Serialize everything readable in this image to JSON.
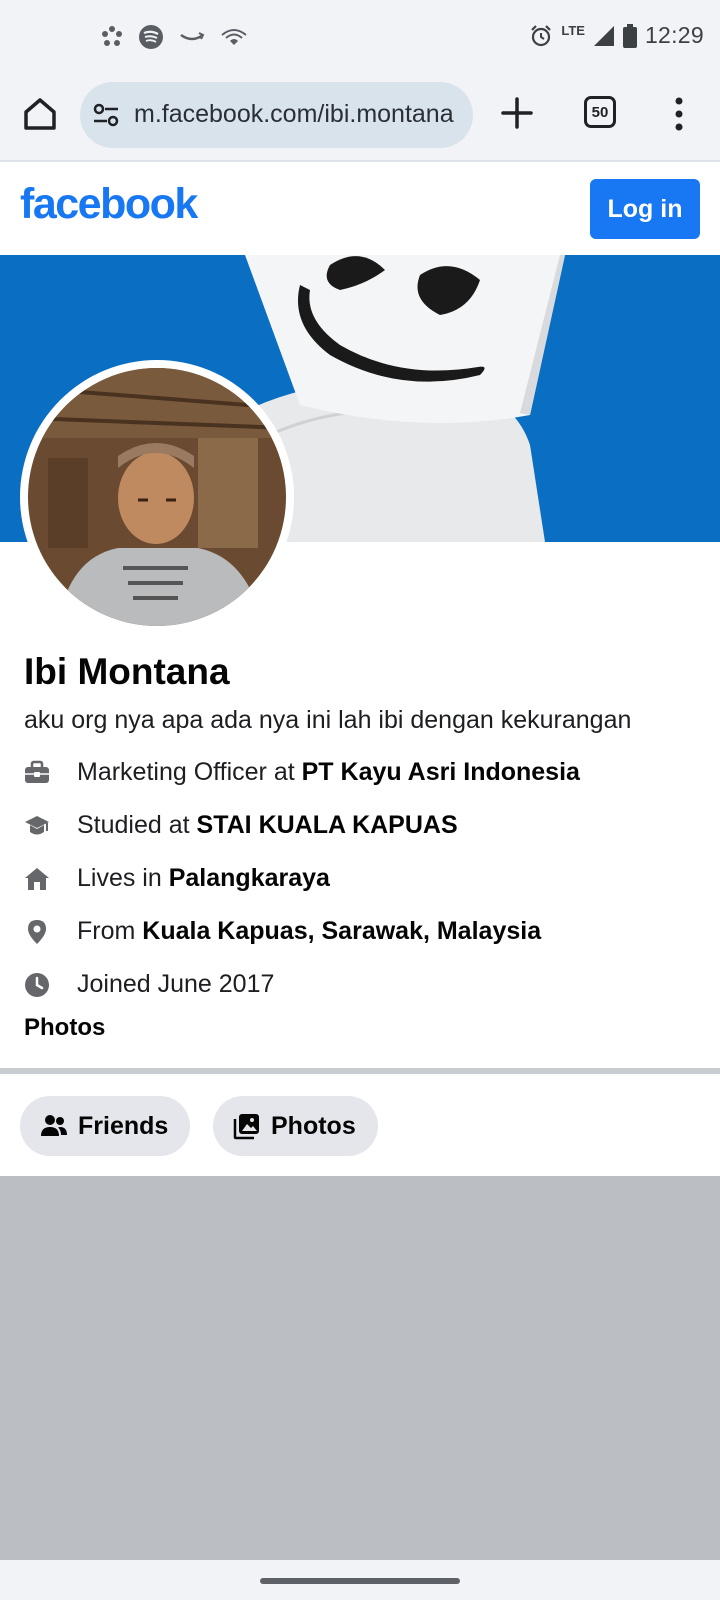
{
  "status_bar": {
    "time": "12:29",
    "network": "LTE",
    "left_icons": [
      "pinwheel-icon",
      "spotify-icon",
      "amazon-smile-icon",
      "wifi-calling-icon"
    ],
    "right_icons": [
      "alarm-icon",
      "signal-icon",
      "battery-icon"
    ]
  },
  "browser": {
    "url": "m.facebook.com/ibi.montana",
    "tab_count": "50"
  },
  "header": {
    "logo": "facebook",
    "login_label": "Log in",
    "brand_color": "#1877f2"
  },
  "profile": {
    "name": "Ibi Montana",
    "bio": "aku org nya apa ada nya ini lah ibi dengan kekurangan",
    "intro": [
      {
        "icon": "briefcase-icon",
        "prefix": "Marketing Officer at ",
        "bold": "PT Kayu Asri Indonesia"
      },
      {
        "icon": "graduation-cap-icon",
        "prefix": "Studied at ",
        "bold": "STAI KUALA KAPUAS"
      },
      {
        "icon": "home-icon",
        "prefix": "Lives in ",
        "bold": "Palangkaraya"
      },
      {
        "icon": "location-pin-icon",
        "prefix": "From ",
        "bold": "Kuala Kapuas, Sarawak, Malaysia"
      },
      {
        "icon": "clock-icon",
        "prefix": "Joined June 2017",
        "bold": ""
      }
    ],
    "photos_heading": "Photos"
  },
  "tabs": {
    "friends_label": "Friends",
    "photos_label": "Photos"
  }
}
